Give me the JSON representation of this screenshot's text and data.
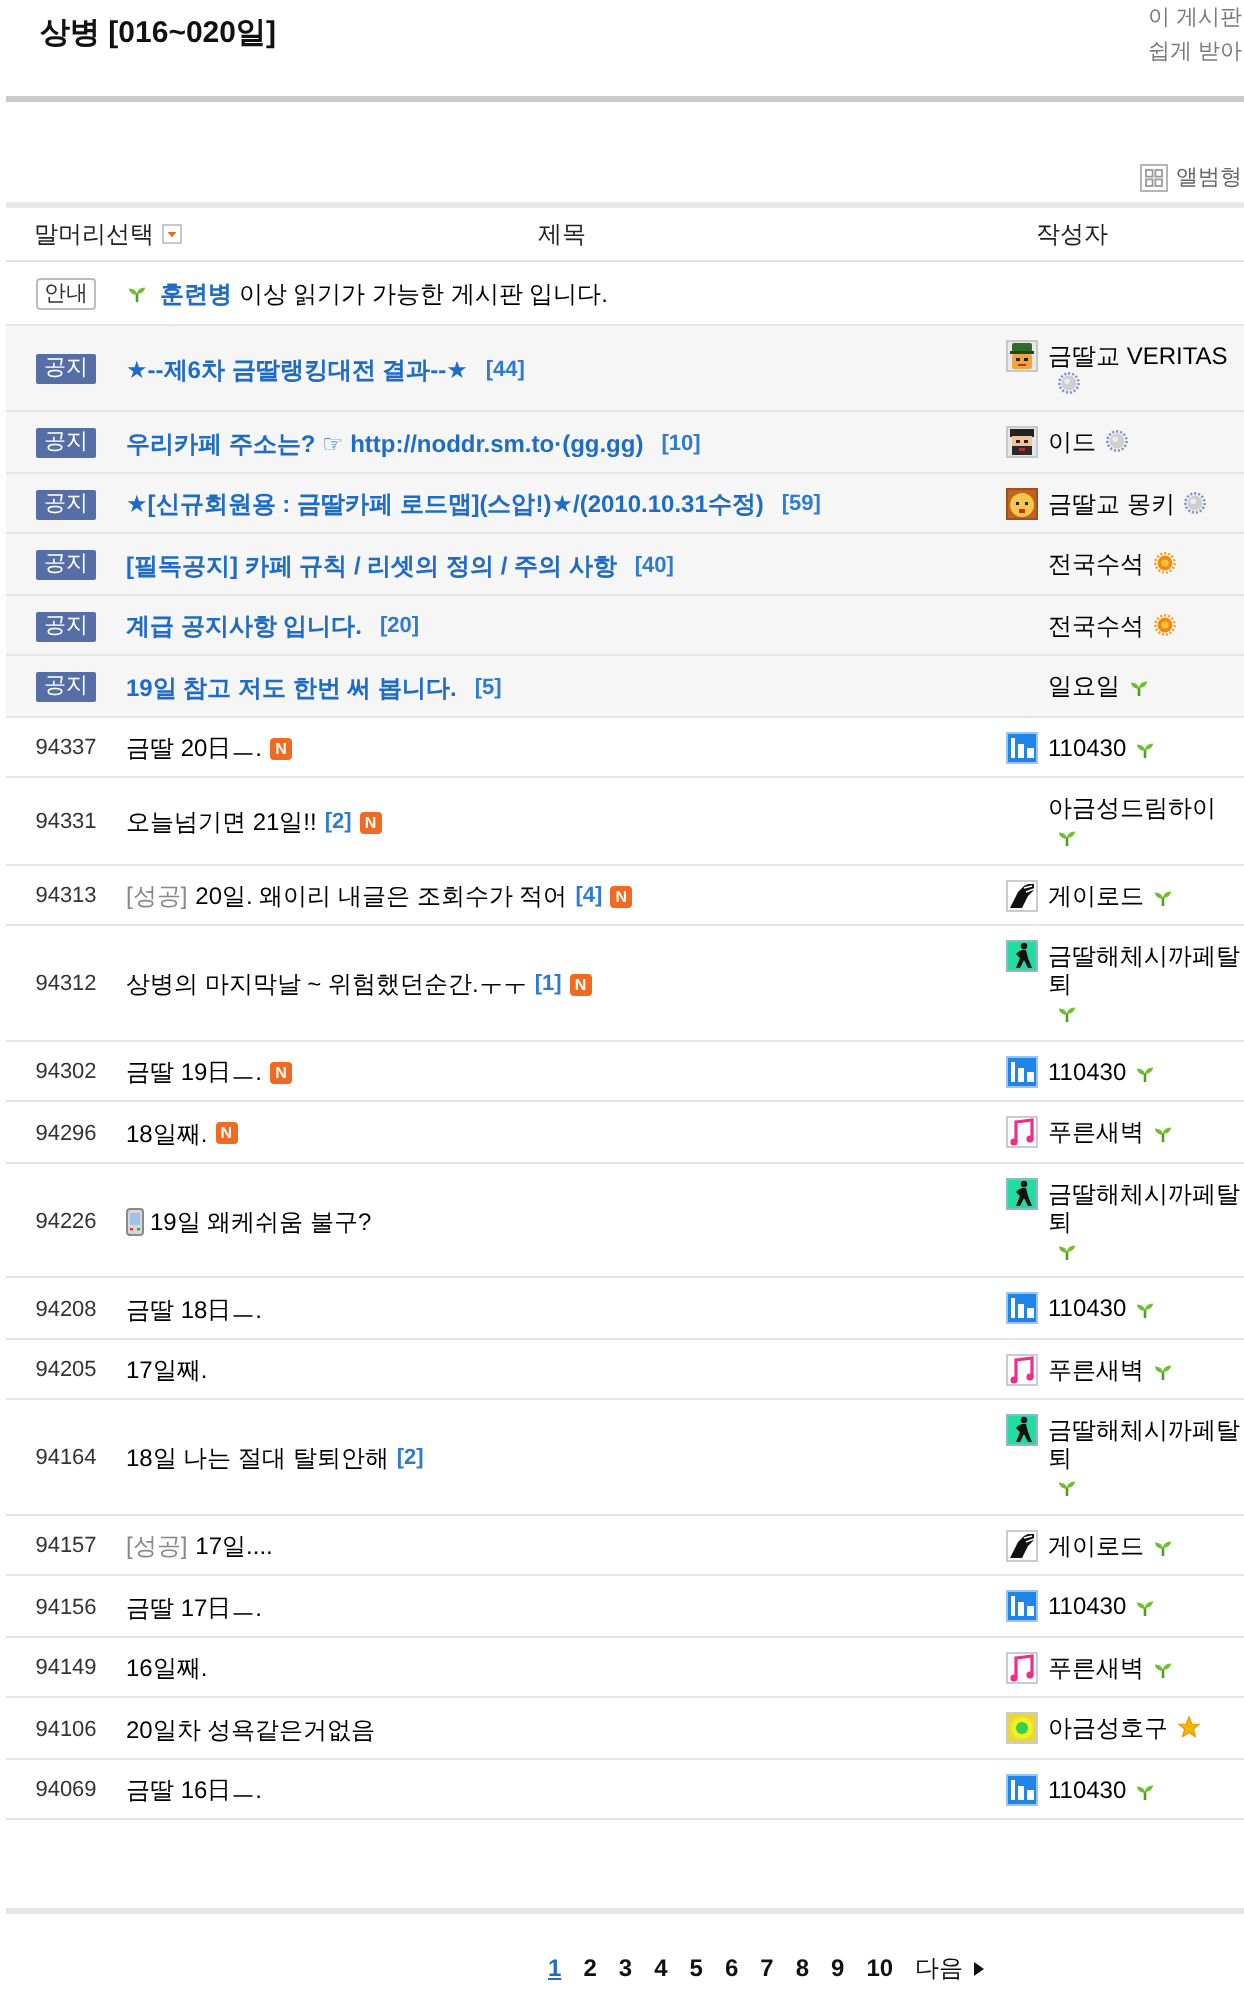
{
  "board": {
    "title": "상병 [016~020일]",
    "side_note": [
      "이 게시판",
      "쉽게 받아"
    ]
  },
  "album_view": {
    "label": "앨범형"
  },
  "columns": [
    {
      "label": "말머리선택",
      "kind": "filter"
    },
    {
      "label": "제목",
      "kind": "title"
    },
    {
      "label": "작성자",
      "kind": "author"
    }
  ],
  "guide": {
    "badge": "안내",
    "level_mark": {
      "kind": "sprout"
    },
    "text": "**훈련병** 이상 읽기가 가능한 게시판 입니다."
  },
  "notices": [
    {
      "badge": "공지",
      "subject": {
        "text": "★--제6차 금딸랭킹대전 결과--★",
        "comments": "[44]"
      },
      "author": {
        "name": "금딸교 VERITAS",
        "avatar": {
          "kind": "soldier"
        },
        "level_mark": {
          "kind": "silver"
        }
      }
    },
    {
      "badge": "공지",
      "subject": {
        "text": "우리카페 주소는? ☞ http://noddr.sm.to·(gg.gg)",
        "comments": "[10]"
      },
      "author": {
        "name": "이드",
        "avatar": {
          "kind": "bearded"
        },
        "level_mark": {
          "kind": "silver"
        }
      }
    },
    {
      "badge": "공지",
      "subject": {
        "text": "★[신규회원용 : 금딸카페 로드맵](스압!)★/(2010.10.31수정)",
        "comments": "[59]"
      },
      "author": {
        "name": "금딸교 몽키",
        "avatar": {
          "kind": "dog"
        },
        "level_mark": {
          "kind": "silver"
        }
      }
    },
    {
      "badge": "공지",
      "subject": {
        "text": "[필독공지] 카페 규칙 / 리셋의 정의 / 주의 사항",
        "comments": "[40]"
      },
      "author": {
        "name": "전국수석",
        "level_mark": {
          "kind": "sun"
        }
      }
    },
    {
      "badge": "공지",
      "subject": {
        "text": "계급 공지사항 입니다.",
        "comments": "[20]"
      },
      "author": {
        "name": "전국수석",
        "level_mark": {
          "kind": "sun"
        }
      }
    },
    {
      "badge": "공지",
      "subject": {
        "text": "19일 참고 저도 한번 써 봅니다.",
        "comments": "[5]"
      },
      "author": {
        "name": "일요일",
        "level_mark": {
          "kind": "sprout"
        }
      }
    }
  ],
  "rows": [
    {
      "number": "94337",
      "subject": {
        "mobile": false,
        "text": "금딸 20日ㅡ.",
        "new_badge": "N"
      },
      "author": {
        "name": "110430",
        "avatar": {
          "kind": "tile"
        },
        "level_mark": {
          "kind": "sprout"
        }
      }
    },
    {
      "number": "94331",
      "subject": {
        "mobile": false,
        "text": "오늘넘기면 21일!!",
        "comments": "[2]",
        "new_badge": "N"
      },
      "author": {
        "name": "아금성드림하이",
        "level_mark": {
          "kind": "sprout"
        }
      }
    },
    {
      "number": "94313",
      "subject": {
        "mobile": false,
        "prefix": "[성공]",
        "text": "20일. 왜이리 내글은 조회수가 적어",
        "comments": "[4]",
        "new_badge": "N"
      },
      "author": {
        "name": "게이로드",
        "avatar": {
          "kind": "hand"
        },
        "level_mark": {
          "kind": "sprout"
        }
      }
    },
    {
      "number": "94312",
      "subject": {
        "mobile": false,
        "text": "상병의 마지막날 ~ 위험했던순간.ㅜㅜ",
        "comments": "[1]",
        "new_badge": "N"
      },
      "author": {
        "name": "금딸해체시까페탈퇴",
        "avatar": {
          "kind": "figure"
        },
        "level_mark": {
          "kind": "sprout"
        }
      }
    },
    {
      "number": "94302",
      "subject": {
        "mobile": false,
        "text": "금딸 19日ㅡ.",
        "new_badge": "N"
      },
      "author": {
        "name": "110430",
        "avatar": {
          "kind": "tile"
        },
        "level_mark": {
          "kind": "sprout"
        }
      }
    },
    {
      "number": "94296",
      "subject": {
        "mobile": false,
        "text": "18일째.",
        "new_badge": "N"
      },
      "author": {
        "name": "푸른새벽",
        "avatar": {
          "kind": "note"
        },
        "level_mark": {
          "kind": "sprout"
        }
      }
    },
    {
      "number": "94226",
      "subject": {
        "mobile": true,
        "text": "19일 왜케쉬움 불구?"
      },
      "author": {
        "name": "금딸해체시까페탈퇴",
        "avatar": {
          "kind": "figure"
        },
        "level_mark": {
          "kind": "sprout"
        }
      }
    },
    {
      "number": "94208",
      "subject": {
        "mobile": false,
        "text": "금딸 18日ㅡ."
      },
      "author": {
        "name": "110430",
        "avatar": {
          "kind": "tile"
        },
        "level_mark": {
          "kind": "sprout"
        }
      }
    },
    {
      "number": "94205",
      "subject": {
        "mobile": false,
        "text": "17일째."
      },
      "author": {
        "name": "푸른새벽",
        "avatar": {
          "kind": "note"
        },
        "level_mark": {
          "kind": "sprout"
        }
      }
    },
    {
      "number": "94164",
      "subject": {
        "mobile": false,
        "text": "18일 나는 절대 탈퇴안해",
        "comments": "[2]"
      },
      "author": {
        "name": "금딸해체시까페탈퇴",
        "avatar": {
          "kind": "figure"
        },
        "level_mark": {
          "kind": "sprout"
        }
      }
    },
    {
      "number": "94157",
      "subject": {
        "mobile": false,
        "prefix": "[성공]",
        "text": "17일...."
      },
      "author": {
        "name": "게이로드",
        "avatar": {
          "kind": "hand"
        },
        "level_mark": {
          "kind": "sprout"
        }
      }
    },
    {
      "number": "94156",
      "subject": {
        "mobile": false,
        "text": "금딸 17日ㅡ."
      },
      "author": {
        "name": "110430",
        "avatar": {
          "kind": "tile"
        },
        "level_mark": {
          "kind": "sprout"
        }
      }
    },
    {
      "number": "94149",
      "subject": {
        "mobile": false,
        "text": "16일째."
      },
      "author": {
        "name": "푸른새벽",
        "avatar": {
          "kind": "note"
        },
        "level_mark": {
          "kind": "sprout"
        }
      }
    },
    {
      "number": "94106",
      "subject": {
        "mobile": false,
        "text": "20일차 성욕같은거없음"
      },
      "author": {
        "name": "아금성호구",
        "avatar": {
          "kind": "dot"
        },
        "level_mark": {
          "kind": "star"
        }
      }
    },
    {
      "number": "94069",
      "subject": {
        "mobile": false,
        "text": "금딸 16日ㅡ."
      },
      "author": {
        "name": "110430",
        "avatar": {
          "kind": "tile"
        },
        "level_mark": {
          "kind": "sprout"
        }
      }
    }
  ],
  "pagination": {
    "pages": [
      {
        "label": "1",
        "selected": true
      },
      {
        "label": "2",
        "selected": false
      },
      {
        "label": "3",
        "selected": false
      },
      {
        "label": "4",
        "selected": false
      },
      {
        "label": "5",
        "selected": false
      },
      {
        "label": "6",
        "selected": false
      },
      {
        "label": "7",
        "selected": false
      },
      {
        "label": "8",
        "selected": false
      },
      {
        "label": "9",
        "selected": false
      },
      {
        "label": "10",
        "selected": false
      }
    ],
    "next": "다음"
  }
}
